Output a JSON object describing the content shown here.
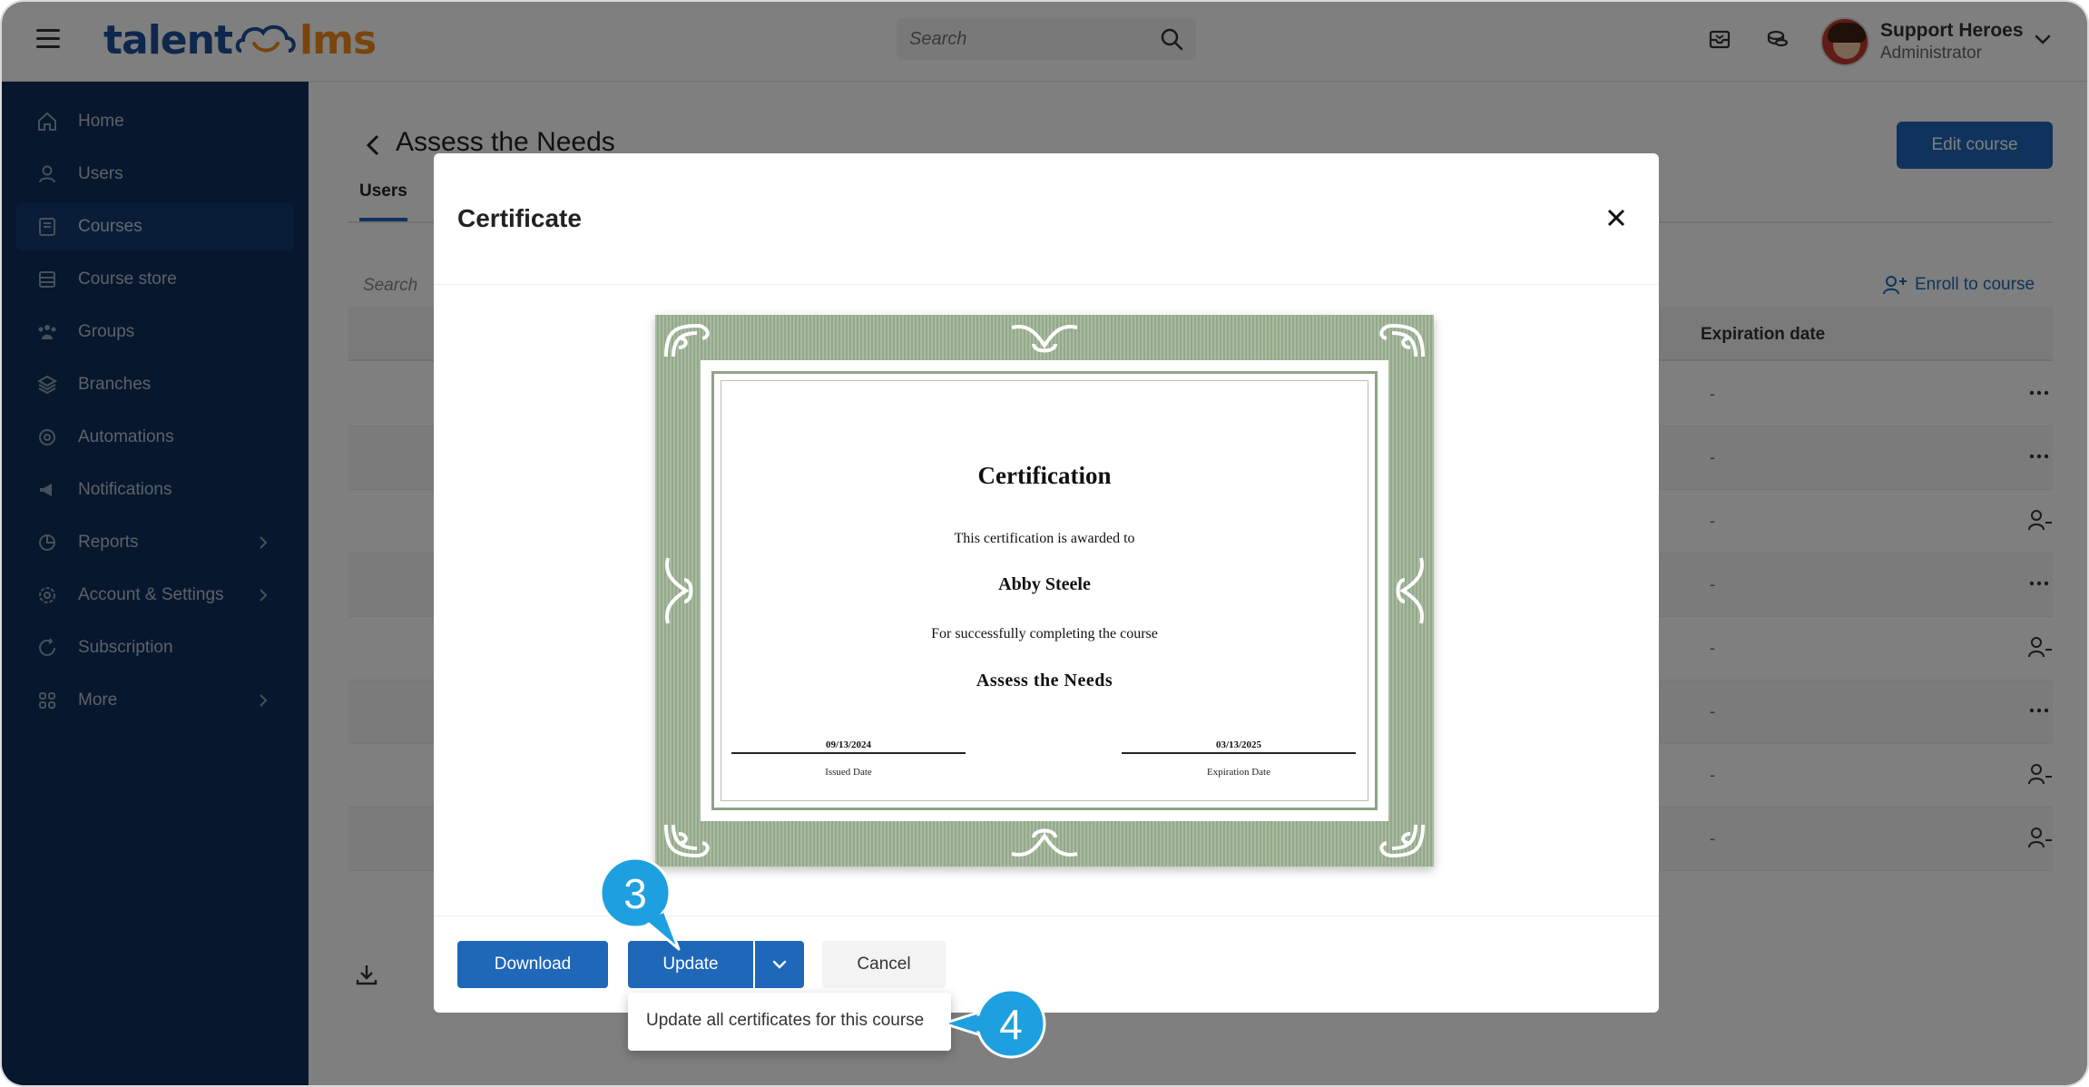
{
  "app": {
    "logo_part1": "talent",
    "logo_part2": "lms"
  },
  "topbar": {
    "search_placeholder": "Search",
    "user_name": "Support Heroes",
    "user_role": "Administrator"
  },
  "sidebar": {
    "items": [
      {
        "label": "Home",
        "icon": "home-icon"
      },
      {
        "label": "Users",
        "icon": "user-icon"
      },
      {
        "label": "Courses",
        "icon": "book-icon",
        "active": true
      },
      {
        "label": "Course store",
        "icon": "store-icon"
      },
      {
        "label": "Groups",
        "icon": "groups-icon"
      },
      {
        "label": "Branches",
        "icon": "layers-icon"
      },
      {
        "label": "Automations",
        "icon": "automation-icon"
      },
      {
        "label": "Notifications",
        "icon": "megaphone-icon"
      },
      {
        "label": "Reports",
        "icon": "pie-chart-icon",
        "submenu": true
      },
      {
        "label": "Account & Settings",
        "icon": "gear-icon",
        "submenu": true
      },
      {
        "label": "Subscription",
        "icon": "refresh-icon"
      },
      {
        "label": "More",
        "icon": "grid-icon",
        "submenu": true
      }
    ]
  },
  "main": {
    "title": "Assess the Needs",
    "edit_course": "Edit course",
    "tab_users": "Users",
    "search_placeholder": "Search",
    "enroll": "Enroll to course",
    "col_expiration": "Expiration date",
    "row_dash": "-"
  },
  "modal": {
    "title": "Certificate",
    "certificate": {
      "title": "Certification",
      "awarded_to": "This certification is awarded to",
      "recipient": "Abby Steele",
      "completing": "For successfully completing the course",
      "course": "Assess the Needs",
      "issued_value": "09/13/2024",
      "issued_label": "Issued Date",
      "expiration_value": "03/13/2025",
      "expiration_label": "Expiration Date"
    },
    "download": "Download",
    "update": "Update",
    "cancel": "Cancel",
    "dropdown_option": "Update all certificates for this course"
  },
  "callouts": {
    "step_3": "3",
    "step_4": "4"
  },
  "colors": {
    "primary": "#1f67b8",
    "sidebar": "#0e2f5a",
    "callout": "#1ea0e0",
    "cert_green": "#9caf93"
  }
}
